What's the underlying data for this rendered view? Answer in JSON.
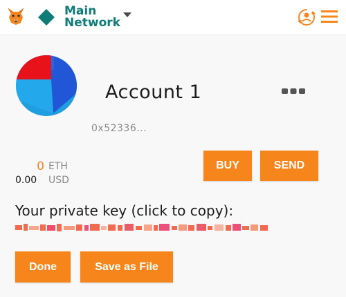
{
  "topbar": {
    "network_line1": "Main",
    "network_line2": "Network"
  },
  "account": {
    "name": "Account 1",
    "address": "0x52336..."
  },
  "balance": {
    "eth_amount": "0",
    "eth_unit": "ETH",
    "usd_amount": "0.00",
    "usd_unit": "USD"
  },
  "actions": {
    "buy_label": "BUY",
    "send_label": "SEND"
  },
  "private_key": {
    "label": "Your private key (click to copy):"
  },
  "footer": {
    "done_label": "Done",
    "save_label": "Save as File"
  },
  "icons": {
    "logo": "metamask-fox-icon",
    "network": "network-diamond-icon",
    "dropdown": "chevron-down-icon",
    "sync": "account-sync-icon",
    "menu": "hamburger-menu-icon",
    "more": "more-options-icon"
  },
  "colors": {
    "accent": "#f6851b",
    "network": "#0f7c78",
    "text": "#1c1c1c",
    "muted": "#8a8a8a"
  }
}
